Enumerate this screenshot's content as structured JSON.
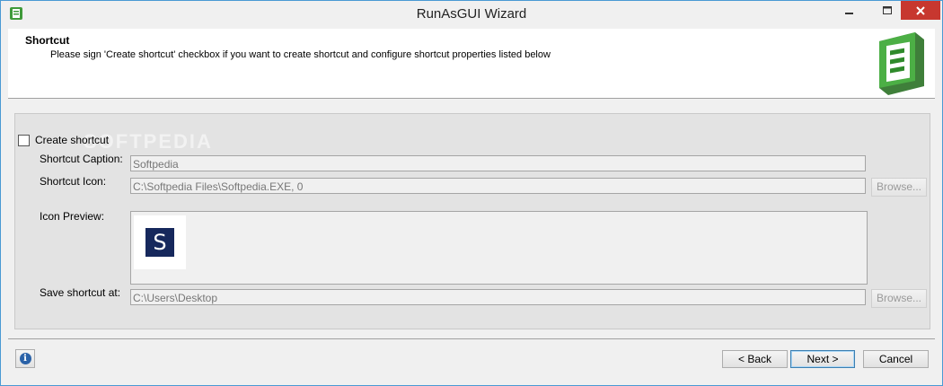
{
  "window": {
    "title": "RunAsGUI Wizard",
    "icons": {
      "app": "app-icon",
      "minimize": "minimize-icon",
      "maximize": "maximize-icon",
      "close": "close-icon"
    }
  },
  "header": {
    "title": "Shortcut",
    "subtitle": "Please sign 'Create shortcut' checkbox if you want to create shortcut and configure shortcut properties listed below",
    "logo_icon": "runasgui-logo-icon"
  },
  "form": {
    "watermark": "SOFTPEDIA",
    "create_shortcut_label": "Create shortcut",
    "create_shortcut_checked": false,
    "caption_label": "Shortcut Caption:",
    "caption_value": "Softpedia",
    "icon_label": "Shortcut Icon:",
    "icon_value": "C:\\Softpedia Files\\Softpedia.EXE, 0",
    "browse_label": "Browse...",
    "preview_label": "Icon Preview:",
    "preview_glyph": "S",
    "save_label": "Save shortcut at:",
    "save_value": "C:\\Users\\Desktop"
  },
  "footer": {
    "info_glyph": "i",
    "back_label": "< Back",
    "next_label": "Next >",
    "cancel_label": "Cancel"
  },
  "colors": {
    "close_button": "#c7372f",
    "accent_border": "#4a9ad4",
    "preview_icon_bg": "#16285c"
  }
}
